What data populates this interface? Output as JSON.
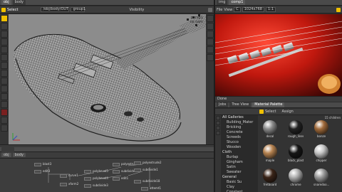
{
  "top_left": {
    "tabs": [
      "obj",
      "body"
    ],
    "path": [
      "obj",
      "body"
    ]
  },
  "viewport_toolbar": {
    "select_label": "Select",
    "node_field": "/obj/body/OUT",
    "group_field": "group1",
    "visibility_label": "Visibility"
  },
  "viewport": {
    "persp_label": "persp1",
    "cam_label": "no cam"
  },
  "render_panel": {
    "tabs": [
      "img",
      "comp1"
    ],
    "menu_items": [
      "File",
      "View"
    ],
    "channel_label": "C",
    "dims": "1024x768",
    "zoom": "1:1",
    "status": "Done"
  },
  "palette_panel": {
    "tabs": [
      "Jobs",
      "Tree View",
      "Material Palette"
    ],
    "toolbar": [
      "Select",
      "Assign"
    ],
    "count_label": "15 children",
    "gallery": [
      {
        "label": "All Galleries",
        "head": true
      },
      {
        "label": "Building_Mater",
        "head": false
      },
      {
        "label": "Bricking",
        "head": false
      },
      {
        "label": "Concrete",
        "head": false
      },
      {
        "label": "Screeds",
        "head": false
      },
      {
        "label": "Stucco",
        "head": false
      },
      {
        "label": "Wooden",
        "head": false
      },
      {
        "label": "Cloth",
        "head": true
      },
      {
        "label": "Burlap",
        "head": false
      },
      {
        "label": "Gingham",
        "head": false
      },
      {
        "label": "Satin",
        "head": false
      },
      {
        "label": "Sweater",
        "head": false
      },
      {
        "label": "General",
        "head": true
      },
      {
        "label": "Basic Su",
        "head": false
      },
      {
        "label": "Clay",
        "head": false
      },
      {
        "label": "Constant",
        "head": false
      }
    ],
    "materials": [
      {
        "label": "decal",
        "color": "#8a8a8a"
      },
      {
        "label": "rough_lines",
        "color": "#222222"
      },
      {
        "label": "bonze",
        "color": "#a06a3a"
      },
      {
        "label": "maple",
        "color": "#b58250"
      },
      {
        "label": "black_plastic",
        "color": "#161616"
      },
      {
        "label": "chipper",
        "color": "#c5c5c5"
      },
      {
        "label": "fretboard",
        "color": "#3a2418"
      },
      {
        "label": "chrome",
        "color": "#b0b0b0"
      },
      {
        "label": "snaredoo...",
        "color": "#9a9a9a"
      }
    ]
  },
  "network": {
    "tabs": [
      "obj",
      "body"
    ],
    "nodes": [
      {
        "label": "blast3"
      },
      {
        "label": "edit3"
      },
      {
        "label": "curve1"
      },
      {
        "label": "xform2"
      },
      {
        "label": "polybevel5"
      },
      {
        "label": "polybevel4"
      },
      {
        "label": "subdivide3"
      },
      {
        "label": "polyextrude1"
      },
      {
        "label": "subdivide2"
      },
      {
        "label": "edit1"
      },
      {
        "label": "polyextrude2"
      },
      {
        "label": "subdivide1"
      },
      {
        "label": "subdivide18"
      },
      {
        "label": "attemt1"
      }
    ],
    "label": "Geometry"
  },
  "colors": {
    "accent": "#f0c000",
    "panel_bg": "#2e2e2e",
    "viewport_bg": "#8c8c8c"
  }
}
